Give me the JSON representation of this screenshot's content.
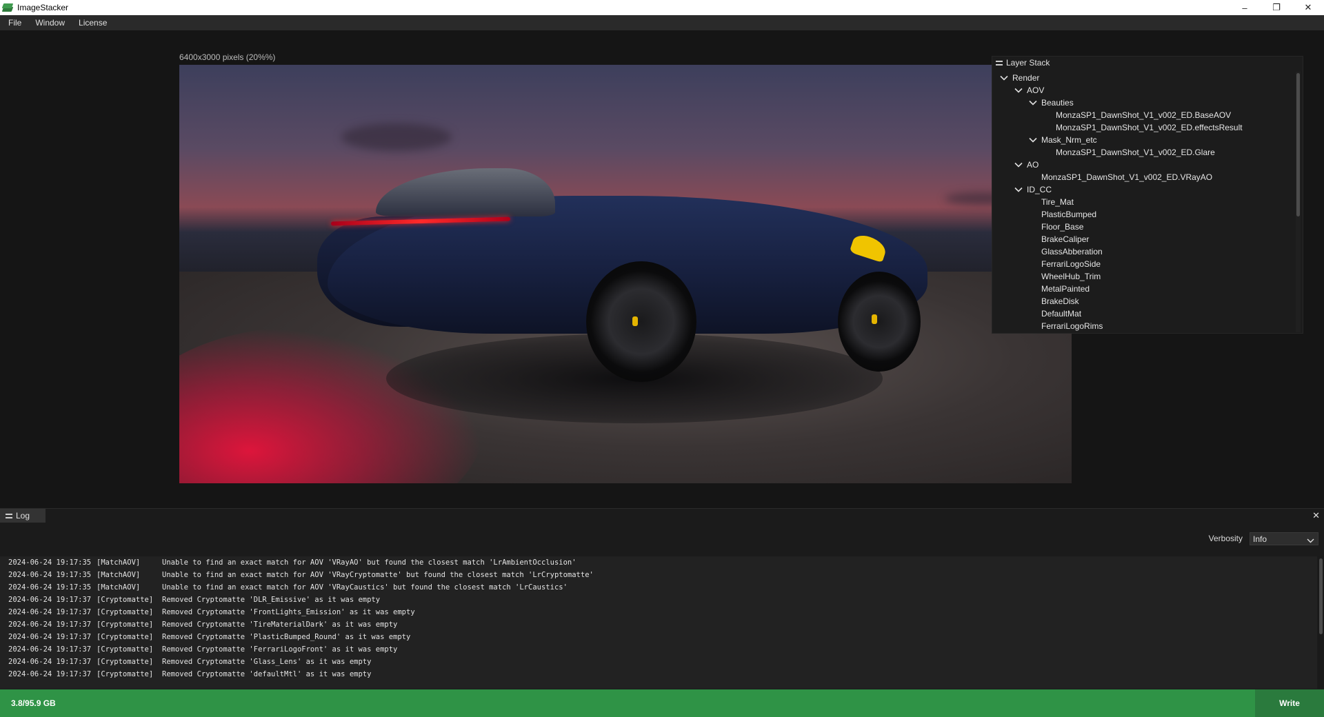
{
  "app": {
    "title": "ImageStacker",
    "icon": "app-stack-icon"
  },
  "window_controls": {
    "minimize": "–",
    "restore": "❐",
    "close": "✕"
  },
  "menu": {
    "items": [
      "File",
      "Window",
      "License"
    ]
  },
  "viewport": {
    "image_info": "6400x3000 pixels (20%%)"
  },
  "layer_stack": {
    "title": "Layer Stack",
    "tree": [
      {
        "label": "Render",
        "depth": 0,
        "expandable": true
      },
      {
        "label": "AOV",
        "depth": 1,
        "expandable": true
      },
      {
        "label": "Beauties",
        "depth": 2,
        "expandable": true
      },
      {
        "label": "MonzaSP1_DawnShot_V1_v002_ED.BaseAOV",
        "depth": 3,
        "expandable": false
      },
      {
        "label": "MonzaSP1_DawnShot_V1_v002_ED.effectsResult",
        "depth": 3,
        "expandable": false
      },
      {
        "label": "Mask_Nrm_etc",
        "depth": 2,
        "expandable": true
      },
      {
        "label": "MonzaSP1_DawnShot_V1_v002_ED.Glare",
        "depth": 3,
        "expandable": false
      },
      {
        "label": "AO",
        "depth": 1,
        "expandable": true
      },
      {
        "label": "MonzaSP1_DawnShot_V1_v002_ED.VRayAO",
        "depth": 2,
        "expandable": false
      },
      {
        "label": "ID_CC",
        "depth": 1,
        "expandable": true
      },
      {
        "label": "Tire_Mat",
        "depth": 2,
        "expandable": false
      },
      {
        "label": "PlasticBumped",
        "depth": 2,
        "expandable": false
      },
      {
        "label": "Floor_Base",
        "depth": 2,
        "expandable": false
      },
      {
        "label": "BrakeCaliper",
        "depth": 2,
        "expandable": false
      },
      {
        "label": "GlassAbberation",
        "depth": 2,
        "expandable": false
      },
      {
        "label": "FerrariLogoSide",
        "depth": 2,
        "expandable": false
      },
      {
        "label": "WheelHub_Trim",
        "depth": 2,
        "expandable": false
      },
      {
        "label": "MetalPainted",
        "depth": 2,
        "expandable": false
      },
      {
        "label": "BrakeDisk",
        "depth": 2,
        "expandable": false
      },
      {
        "label": "DefaultMat",
        "depth": 2,
        "expandable": false
      },
      {
        "label": "FerrariLogoRims",
        "depth": 2,
        "expandable": false
      }
    ]
  },
  "log": {
    "tab_label": "Log",
    "close": "✕",
    "verbosity_label": "Verbosity",
    "verbosity_value": "Info",
    "lines": [
      {
        "time": "2024-06-24 19:17:35",
        "tag": "[MatchAOV]",
        "msg": "Unable to find an exact match for AOV 'VRayAO' but found the closest match 'LrAmbientOcclusion'"
      },
      {
        "time": "2024-06-24 19:17:35",
        "tag": "[MatchAOV]",
        "msg": "Unable to find an exact match for AOV 'VRayCryptomatte' but found the closest match 'LrCryptomatte'"
      },
      {
        "time": "2024-06-24 19:17:35",
        "tag": "[MatchAOV]",
        "msg": "Unable to find an exact match for AOV 'VRayCaustics' but found the closest match 'LrCaustics'"
      },
      {
        "time": "2024-06-24 19:17:37",
        "tag": "[Cryptomatte]",
        "msg": "Removed Cryptomatte 'DLR_Emissive' as it was empty"
      },
      {
        "time": "2024-06-24 19:17:37",
        "tag": "[Cryptomatte]",
        "msg": "Removed Cryptomatte 'FrontLights_Emission' as it was empty"
      },
      {
        "time": "2024-06-24 19:17:37",
        "tag": "[Cryptomatte]",
        "msg": "Removed Cryptomatte 'TireMaterialDark' as it was empty"
      },
      {
        "time": "2024-06-24 19:17:37",
        "tag": "[Cryptomatte]",
        "msg": "Removed Cryptomatte 'PlasticBumped_Round' as it was empty"
      },
      {
        "time": "2024-06-24 19:17:37",
        "tag": "[Cryptomatte]",
        "msg": "Removed Cryptomatte 'FerrariLogoFront' as it was empty"
      },
      {
        "time": "2024-06-24 19:17:37",
        "tag": "[Cryptomatte]",
        "msg": "Removed Cryptomatte 'Glass_Lens' as it was empty"
      },
      {
        "time": "2024-06-24 19:17:37",
        "tag": "[Cryptomatte]",
        "msg": "Removed Cryptomatte 'defaultMtl' as it was empty"
      }
    ]
  },
  "status": {
    "memory": "3.8/95.9 GB",
    "write_label": "Write",
    "color": "#2f9346"
  }
}
